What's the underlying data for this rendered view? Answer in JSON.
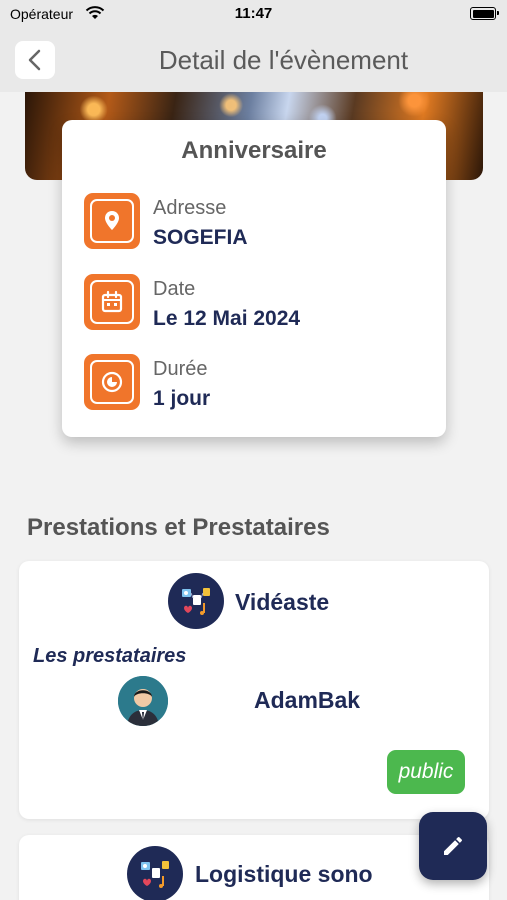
{
  "status_bar": {
    "carrier": "Opérateur",
    "time": "11:47"
  },
  "header": {
    "title": "Detail de l'évènement"
  },
  "event": {
    "title": "Anniversaire",
    "rows": [
      {
        "label": "Adresse",
        "value": "SOGEFIA",
        "icon": "location-pin-icon"
      },
      {
        "label": "Date",
        "value": "Le 12 Mai 2024",
        "icon": "calendar-icon"
      },
      {
        "label": "Durée",
        "value": "1 jour",
        "icon": "timer-icon"
      }
    ]
  },
  "section": {
    "title": "Prestations et Prestataires"
  },
  "services": [
    {
      "name": "Vidéaste",
      "providers_label": "Les prestataires",
      "provider_name": "AdamBak",
      "visibility": "public"
    },
    {
      "name": "Logistique sono"
    }
  ],
  "colors": {
    "accent": "#f0752b",
    "navy": "#1f2a56",
    "badge": "#4cb84e"
  }
}
